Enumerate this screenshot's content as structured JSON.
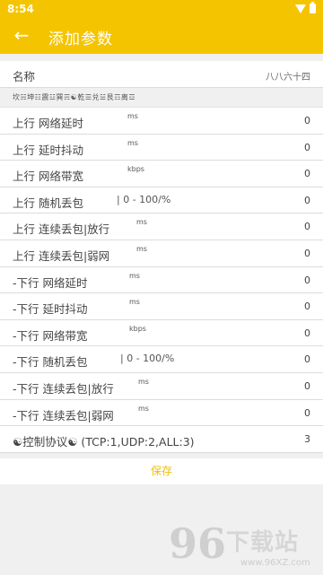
{
  "status": {
    "time": "8:54"
  },
  "appbar": {
    "title": "添加参数",
    "back_icon": "arrow-left-icon"
  },
  "name_row": {
    "label": "名称",
    "value": "八八六十四"
  },
  "trigram_row": {
    "label": "坎☵坤☷震☳巽☴☯乾☰兑☱艮☶离☲"
  },
  "rows": [
    {
      "label": "上行 网络延时",
      "unit": "ms",
      "value": "0"
    },
    {
      "label": "上行 延时抖动",
      "unit": "ms",
      "value": "0"
    },
    {
      "label": "上行 网络带宽",
      "unit": "kbps",
      "value": "0"
    },
    {
      "label": "上行 随机丢包",
      "unit": "| 0 - 100/%",
      "value": "0"
    },
    {
      "label": "上行 连续丢包|放行",
      "unit": "ms",
      "value": "0"
    },
    {
      "label": "上行 连续丢包|弱网",
      "unit": "ms",
      "value": "0"
    },
    {
      "label": "-下行 网络延时",
      "unit": "ms",
      "value": "0"
    },
    {
      "label": "-下行 延时抖动",
      "unit": "ms",
      "value": "0"
    },
    {
      "label": "-下行 网络带宽",
      "unit": "kbps",
      "value": "0"
    },
    {
      "label": "-下行 随机丢包",
      "unit": "| 0 - 100/%",
      "value": "0"
    },
    {
      "label": "-下行 连续丢包|放行",
      "unit": "ms",
      "value": "0"
    },
    {
      "label": "-下行 连续丢包|弱网",
      "unit": "ms",
      "value": "0"
    },
    {
      "label": "☯控制协议☯ (TCP:1,UDP:2,ALL:3)",
      "unit": "",
      "value": "3"
    }
  ],
  "save_label": "保存",
  "watermark": {
    "number": "96",
    "brand": "下载站",
    "url": "www.96XZ.com"
  },
  "colors": {
    "accent": "#f5c400",
    "save_text": "#f0c000"
  }
}
